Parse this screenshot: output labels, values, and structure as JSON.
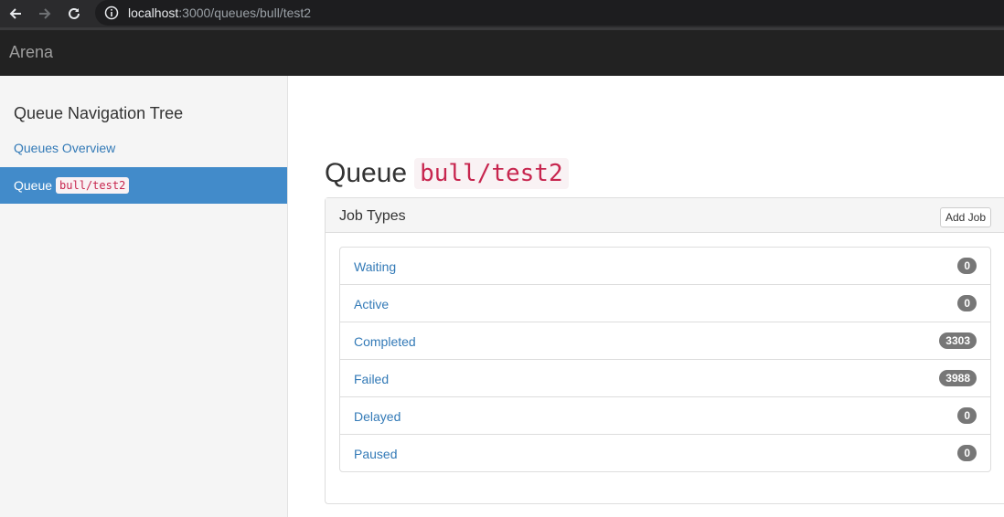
{
  "browser": {
    "url_host": "localhost",
    "url_rest": ":3000/queues/bull/test2",
    "icons": [
      "back-arrow-icon",
      "forward-arrow-icon",
      "reload-icon",
      "info-icon"
    ]
  },
  "navbar": {
    "brand": "Arena"
  },
  "sidebar": {
    "title": "Queue Navigation Tree",
    "overview_link": "Queues Overview",
    "active_item": {
      "label": "Queue",
      "code": "bull/test2"
    }
  },
  "main": {
    "title": "Queue",
    "title_code": "bull/test2",
    "panel": {
      "title": "Job Types",
      "add_job_label": "Add Job",
      "job_types": [
        {
          "label": "Waiting",
          "count": "0"
        },
        {
          "label": "Active",
          "count": "0"
        },
        {
          "label": "Completed",
          "count": "3303"
        },
        {
          "label": "Failed",
          "count": "3988"
        },
        {
          "label": "Delayed",
          "count": "0"
        },
        {
          "label": "Paused",
          "count": "0"
        }
      ]
    }
  },
  "colors": {
    "navbar_bg": "#222222",
    "sidebar_bg": "#f5f5f5",
    "active_bg": "#428bca",
    "link": "#337ab7",
    "badge_bg": "#777777",
    "code_fg": "#c7254e"
  }
}
